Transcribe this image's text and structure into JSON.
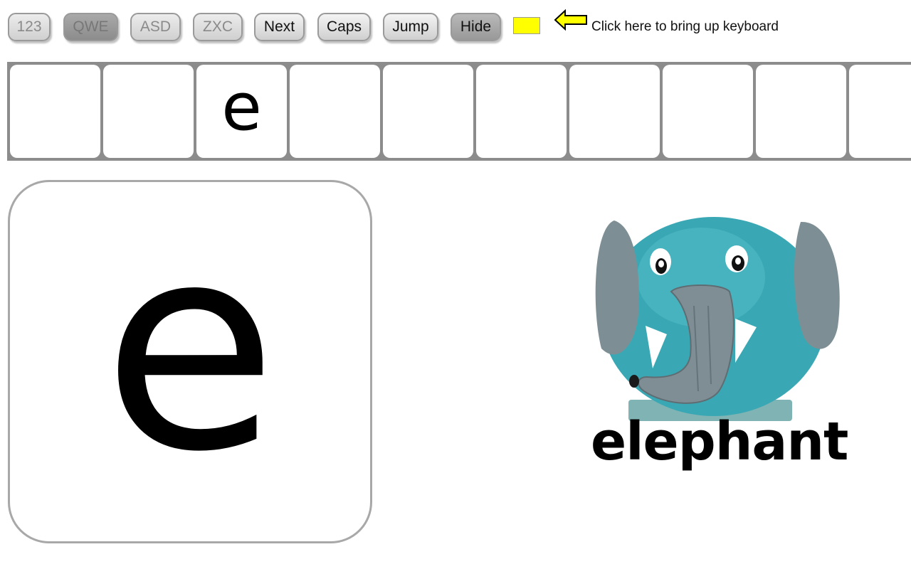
{
  "toolbar": {
    "buttons": [
      {
        "label": "123",
        "state": "disabled"
      },
      {
        "label": "QWE",
        "state": "pressed"
      },
      {
        "label": "ASD",
        "state": "disabled"
      },
      {
        "label": "ZXC",
        "state": "disabled"
      },
      {
        "label": "Next",
        "state": "normal"
      },
      {
        "label": "Caps",
        "state": "normal"
      },
      {
        "label": "Jump",
        "state": "normal"
      },
      {
        "label": "Hide",
        "state": "active"
      }
    ],
    "swatch_color": "#ffff00",
    "arrow_icon": "left-arrow-icon",
    "hint": "Click here to bring up keyboard"
  },
  "strip": {
    "tiles": [
      "",
      "",
      "e",
      "",
      "",
      "",
      "",
      "",
      "",
      ""
    ]
  },
  "card": {
    "letter": "e"
  },
  "picture": {
    "subject": "elephant",
    "word": "elephant"
  }
}
